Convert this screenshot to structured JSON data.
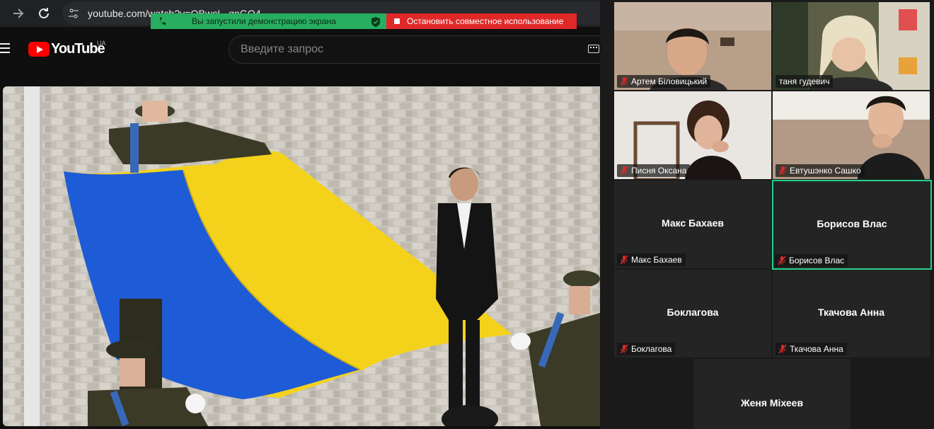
{
  "browser": {
    "url": "youtube.com/watch?v=QBwcL_qnGO4",
    "back_icon": "arrow-right-icon",
    "reload_icon": "reload-icon",
    "site_info_icon": "tune-icon"
  },
  "sharing": {
    "status_text": "Вы запустили демонстрацию экрана",
    "stop_label": "Остановить совместное использование",
    "colors": {
      "status": "#27ae60",
      "stop": "#e02828"
    }
  },
  "youtube": {
    "logo_text": "YouTube",
    "region": "UA",
    "search_placeholder": "Введите запрос"
  },
  "video": {
    "description_icon": "flag-ceremony-image"
  },
  "participants": [
    {
      "name": "Артем Біловицький",
      "video": true,
      "muted": true
    },
    {
      "name": "таня гудевич",
      "video": true,
      "muted": false
    },
    {
      "name": "Писня Оксана",
      "video": true,
      "muted": true
    },
    {
      "name": "Евтушэнко Сашко",
      "video": true,
      "muted": true
    },
    {
      "name": "Макс Бахаев",
      "display": "Макс Бахаев",
      "video": false,
      "muted": true
    },
    {
      "name": "Борисов Влас",
      "display": "Борисов Влас",
      "video": false,
      "muted": true,
      "active_speaker": true
    },
    {
      "name": "Боклагова",
      "display": "Боклагова",
      "video": false,
      "muted": true
    },
    {
      "name": "Ткачова Анна",
      "display": "Ткачова Анна",
      "video": false,
      "muted": true
    },
    {
      "display": "Женя Міхеев",
      "video": false
    }
  ],
  "colors": {
    "active_speaker_border": "#23d18b",
    "muted_icon": "#e02828"
  }
}
